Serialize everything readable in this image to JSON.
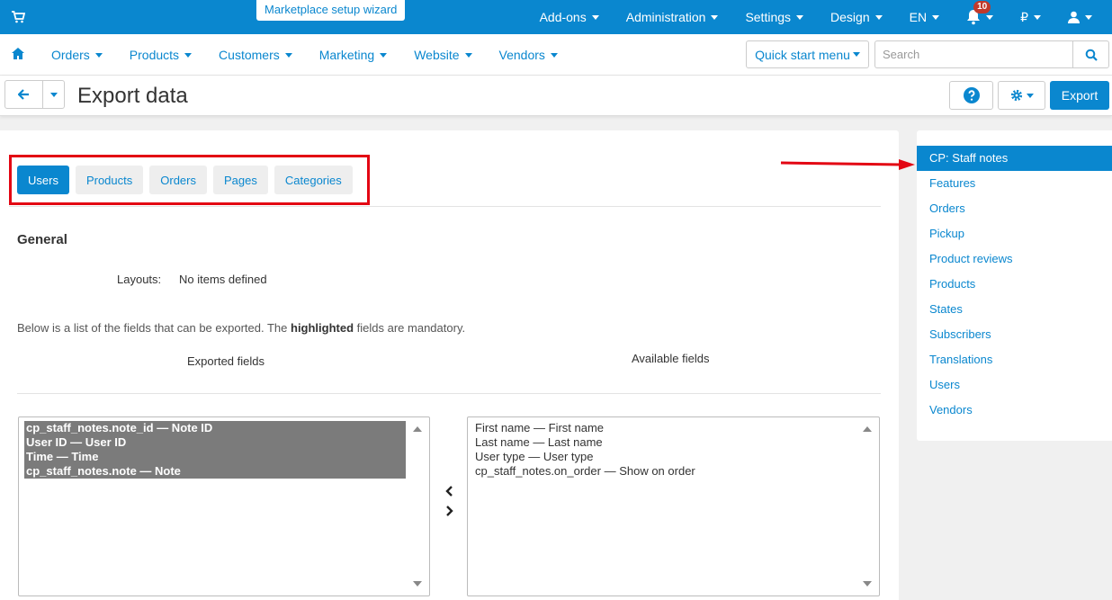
{
  "topbar": {
    "wizard": "Marketplace setup wizard",
    "items": [
      "Add-ons",
      "Administration",
      "Settings",
      "Design",
      "EN"
    ],
    "notification_count": "10",
    "currency": "₽"
  },
  "nav": {
    "items": [
      "Orders",
      "Products",
      "Customers",
      "Marketing",
      "Website",
      "Vendors"
    ],
    "quick_start": "Quick start menu",
    "search_placeholder": "Search"
  },
  "titlebar": {
    "title": "Export data",
    "export": "Export"
  },
  "tabs": [
    "Users",
    "Products",
    "Orders",
    "Pages",
    "Categories"
  ],
  "general": {
    "title": "General",
    "layouts_label": "Layouts:",
    "layouts_value": "No items defined",
    "hint_before": "Below is a list of the fields that can be exported. The ",
    "hint_bold": "highlighted",
    "hint_after": " fields are mandatory.",
    "exported_label": "Exported fields",
    "available_label": "Available fields"
  },
  "exported_fields": [
    "cp_staff_notes.note_id — Note ID",
    "User ID — User ID",
    "Time — Time",
    "cp_staff_notes.note — Note"
  ],
  "available_fields": [
    "First name — First name",
    "Last name — Last name",
    "User type — User type",
    "cp_staff_notes.on_order — Show on order"
  ],
  "side": {
    "items": [
      "CP: Staff notes",
      "Features",
      "Orders",
      "Pickup",
      "Product reviews",
      "Products",
      "States",
      "Subscribers",
      "Translations",
      "Users",
      "Vendors"
    ]
  },
  "colors": {
    "accent": "#0a87cf",
    "highlight": "#e30613",
    "selected_row": "#7b7b7b"
  }
}
